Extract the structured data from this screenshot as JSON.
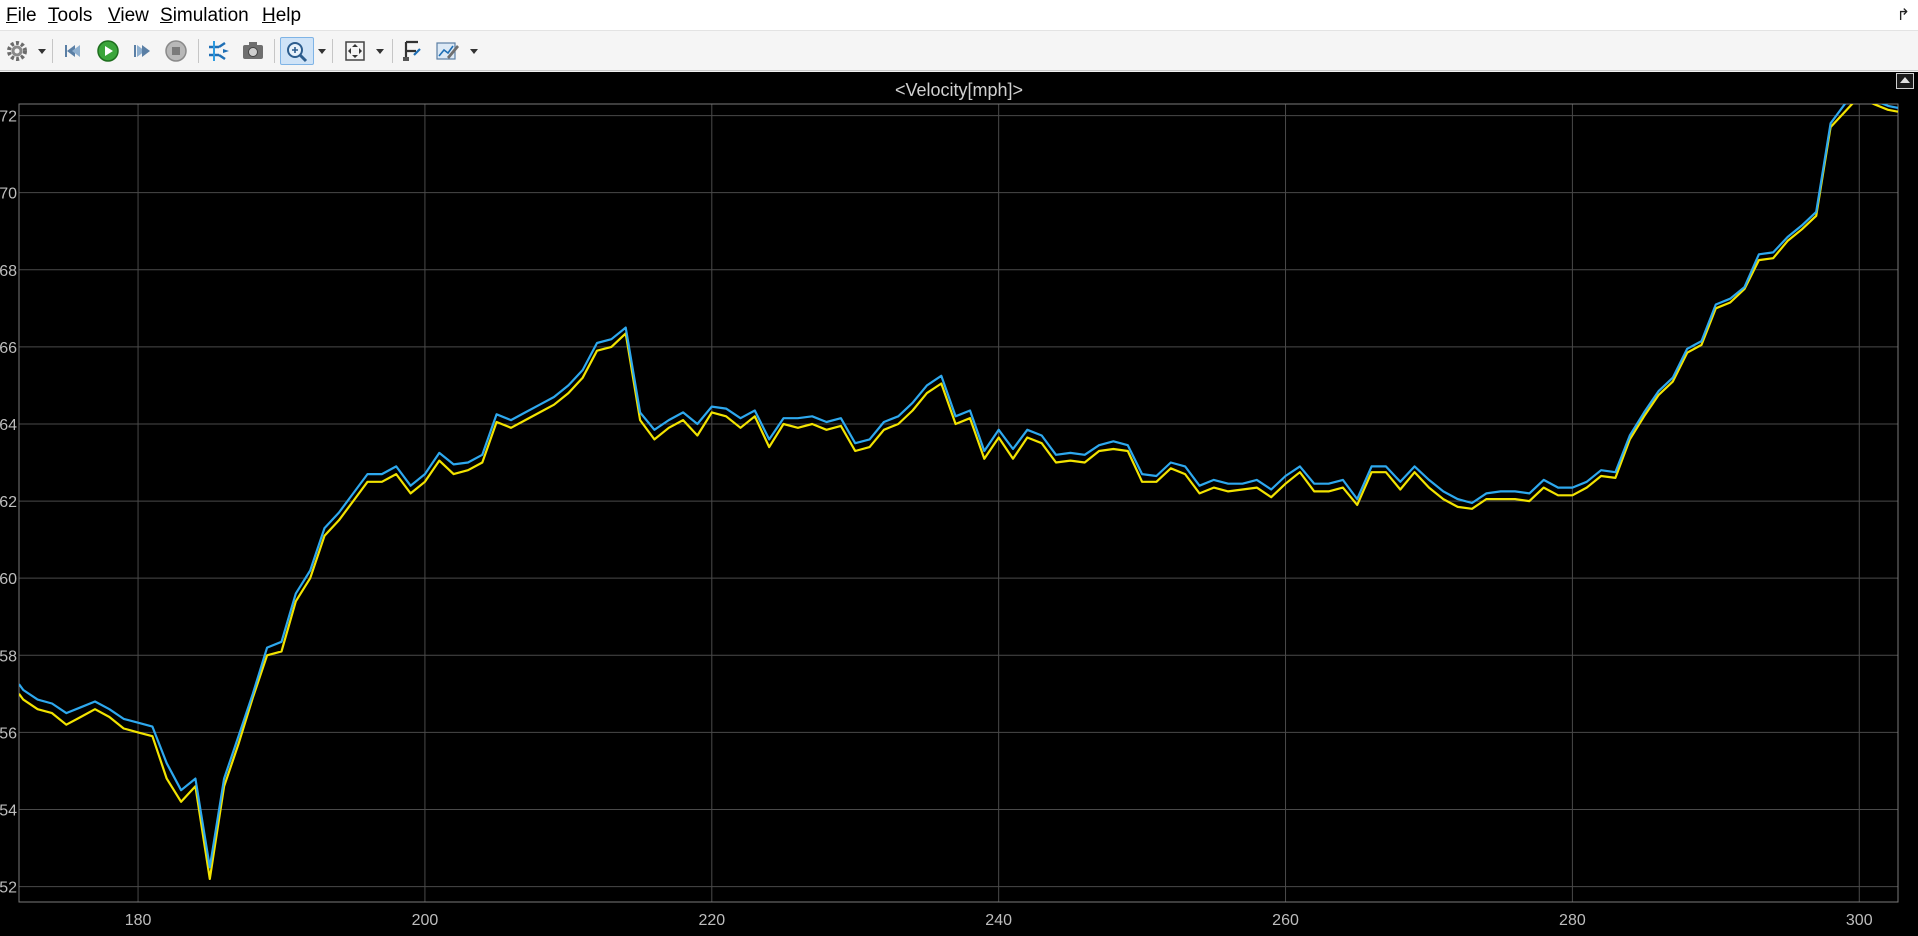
{
  "menubar": {
    "items": [
      {
        "mnemonic": "F",
        "rest": "ile"
      },
      {
        "mnemonic": "T",
        "rest": "ools"
      },
      {
        "mnemonic": "V",
        "rest": "iew"
      },
      {
        "mnemonic": "S",
        "rest": "imulation"
      },
      {
        "mnemonic": "H",
        "rest": "elp"
      }
    ]
  },
  "toolbar": {
    "buttons": [
      {
        "icon": "gear-icon"
      },
      {
        "icon": "step-back-icon"
      },
      {
        "icon": "run-icon"
      },
      {
        "icon": "step-forward-icon"
      },
      {
        "icon": "stop-icon"
      },
      {
        "icon": "signal-selector-icon"
      },
      {
        "icon": "snapshot-icon"
      },
      {
        "icon": "zoom-icon",
        "active": true
      },
      {
        "icon": "fit-to-view-icon"
      },
      {
        "icon": "cursor-measurements-icon"
      },
      {
        "icon": "style-icon"
      }
    ]
  },
  "scope": {
    "title": "<Velocity[mph]>"
  },
  "colors": {
    "background": "#000000",
    "grid": "#4a4a4a",
    "axis_text": "#bdbdbd",
    "series_blue": "#2ea8ee",
    "series_yellow": "#f2e300"
  },
  "chart_data": {
    "type": "line",
    "title": "<Velocity[mph]>",
    "xlabel": "",
    "ylabel": "",
    "xlim": [
      171.7,
      302.7
    ],
    "ylim": [
      51.6,
      72.3
    ],
    "xticks": [
      180,
      200,
      220,
      240,
      260,
      280,
      300
    ],
    "yticks": [
      52,
      54,
      56,
      58,
      60,
      62,
      64,
      66,
      68,
      70,
      72
    ],
    "grid": true,
    "series": [
      {
        "color": "#2ea8ee",
        "x": [
          171.7,
          172,
          173,
          174,
          175,
          176,
          177,
          178,
          179,
          180,
          181,
          182,
          183,
          184,
          185,
          186,
          187,
          188,
          189,
          190,
          191,
          192,
          193,
          194,
          195,
          196,
          197,
          198,
          199,
          200,
          201,
          202,
          203,
          204,
          205,
          206,
          207,
          208,
          209,
          210,
          211,
          212,
          213,
          214,
          215,
          216,
          217,
          218,
          219,
          220,
          221,
          222,
          223,
          224,
          225,
          226,
          227,
          228,
          229,
          230,
          231,
          232,
          233,
          234,
          235,
          236,
          237,
          238,
          239,
          240,
          241,
          242,
          243,
          244,
          245,
          246,
          247,
          248,
          249,
          250,
          251,
          252,
          253,
          254,
          255,
          256,
          257,
          258,
          259,
          260,
          261,
          262,
          263,
          264,
          265,
          266,
          267,
          268,
          269,
          270,
          271,
          272,
          273,
          274,
          275,
          276,
          277,
          278,
          279,
          280,
          281,
          282,
          283,
          284,
          285,
          286,
          287,
          288,
          289,
          290,
          291,
          292,
          293,
          294,
          295,
          296,
          297,
          298,
          299,
          300,
          301,
          302,
          302.7
        ],
        "y": [
          57.25,
          57.1,
          56.85,
          56.75,
          56.5,
          56.65,
          56.8,
          56.6,
          56.35,
          56.25,
          56.15,
          55.2,
          54.5,
          54.8,
          52.5,
          54.8,
          55.9,
          57.0,
          58.2,
          58.35,
          59.6,
          60.2,
          61.3,
          61.7,
          62.2,
          62.7,
          62.7,
          62.9,
          62.4,
          62.7,
          63.25,
          62.95,
          63.0,
          63.2,
          64.25,
          64.1,
          64.3,
          64.5,
          64.7,
          65.0,
          65.4,
          66.1,
          66.2,
          66.5,
          64.3,
          63.85,
          64.1,
          64.3,
          64.0,
          64.45,
          64.4,
          64.15,
          64.35,
          63.6,
          64.15,
          64.15,
          64.2,
          64.05,
          64.15,
          63.5,
          63.6,
          64.05,
          64.2,
          64.55,
          65.0,
          65.25,
          64.2,
          64.35,
          63.3,
          63.85,
          63.35,
          63.85,
          63.7,
          63.2,
          63.25,
          63.2,
          63.45,
          63.55,
          63.45,
          62.7,
          62.65,
          63.0,
          62.9,
          62.4,
          62.55,
          62.45,
          62.45,
          62.55,
          62.3,
          62.65,
          62.9,
          62.45,
          62.45,
          62.55,
          62.05,
          62.9,
          62.9,
          62.5,
          62.9,
          62.55,
          62.25,
          62.05,
          61.95,
          62.2,
          62.25,
          62.25,
          62.2,
          62.55,
          62.35,
          62.35,
          62.5,
          62.8,
          62.75,
          63.7,
          64.3,
          64.85,
          65.2,
          65.95,
          66.15,
          67.1,
          67.25,
          67.55,
          68.4,
          68.45,
          68.85,
          69.15,
          69.5,
          71.8,
          72.3,
          72.6,
          72.4,
          72.25,
          72.2
        ]
      },
      {
        "color": "#f2e300",
        "x": [
          171.7,
          172,
          173,
          174,
          175,
          176,
          177,
          178,
          179,
          180,
          181,
          182,
          183,
          184,
          185,
          186,
          187,
          188,
          189,
          190,
          191,
          192,
          193,
          194,
          195,
          196,
          197,
          198,
          199,
          200,
          201,
          202,
          203,
          204,
          205,
          206,
          207,
          208,
          209,
          210,
          211,
          212,
          213,
          214,
          215,
          216,
          217,
          218,
          219,
          220,
          221,
          222,
          223,
          224,
          225,
          226,
          227,
          228,
          229,
          230,
          231,
          232,
          233,
          234,
          235,
          236,
          237,
          238,
          239,
          240,
          241,
          242,
          243,
          244,
          245,
          246,
          247,
          248,
          249,
          250,
          251,
          252,
          253,
          254,
          255,
          256,
          257,
          258,
          259,
          260,
          261,
          262,
          263,
          264,
          265,
          266,
          267,
          268,
          269,
          270,
          271,
          272,
          273,
          274,
          275,
          276,
          277,
          278,
          279,
          280,
          281,
          282,
          283,
          284,
          285,
          286,
          287,
          288,
          289,
          290,
          291,
          292,
          293,
          294,
          295,
          296,
          297,
          298,
          299,
          300,
          301,
          302,
          302.7
        ],
        "y": [
          57.0,
          56.85,
          56.6,
          56.5,
          56.2,
          56.4,
          56.6,
          56.4,
          56.1,
          56.0,
          55.9,
          54.8,
          54.2,
          54.6,
          52.2,
          54.6,
          55.7,
          56.9,
          58.0,
          58.1,
          59.4,
          60.0,
          61.1,
          61.5,
          62.0,
          62.5,
          62.5,
          62.7,
          62.2,
          62.5,
          63.05,
          62.7,
          62.8,
          63.0,
          64.05,
          63.9,
          64.1,
          64.3,
          64.5,
          64.8,
          65.2,
          65.9,
          66.0,
          66.35,
          64.1,
          63.6,
          63.9,
          64.1,
          63.7,
          64.3,
          64.2,
          63.9,
          64.2,
          63.4,
          64.0,
          63.9,
          64.0,
          63.85,
          63.95,
          63.3,
          63.4,
          63.85,
          64.0,
          64.35,
          64.8,
          65.05,
          64.0,
          64.15,
          63.1,
          63.65,
          63.1,
          63.65,
          63.5,
          63.0,
          63.05,
          63.0,
          63.3,
          63.35,
          63.3,
          62.5,
          62.5,
          62.85,
          62.7,
          62.2,
          62.35,
          62.25,
          62.3,
          62.35,
          62.1,
          62.45,
          62.75,
          62.25,
          62.25,
          62.35,
          61.9,
          62.75,
          62.75,
          62.3,
          62.75,
          62.35,
          62.05,
          61.85,
          61.8,
          62.05,
          62.05,
          62.05,
          62.0,
          62.35,
          62.15,
          62.15,
          62.35,
          62.65,
          62.6,
          63.6,
          64.2,
          64.75,
          65.1,
          65.85,
          66.05,
          67.0,
          67.15,
          67.5,
          68.25,
          68.3,
          68.75,
          69.05,
          69.4,
          71.7,
          72.1,
          72.5,
          72.3,
          72.15,
          72.1
        ]
      }
    ]
  }
}
